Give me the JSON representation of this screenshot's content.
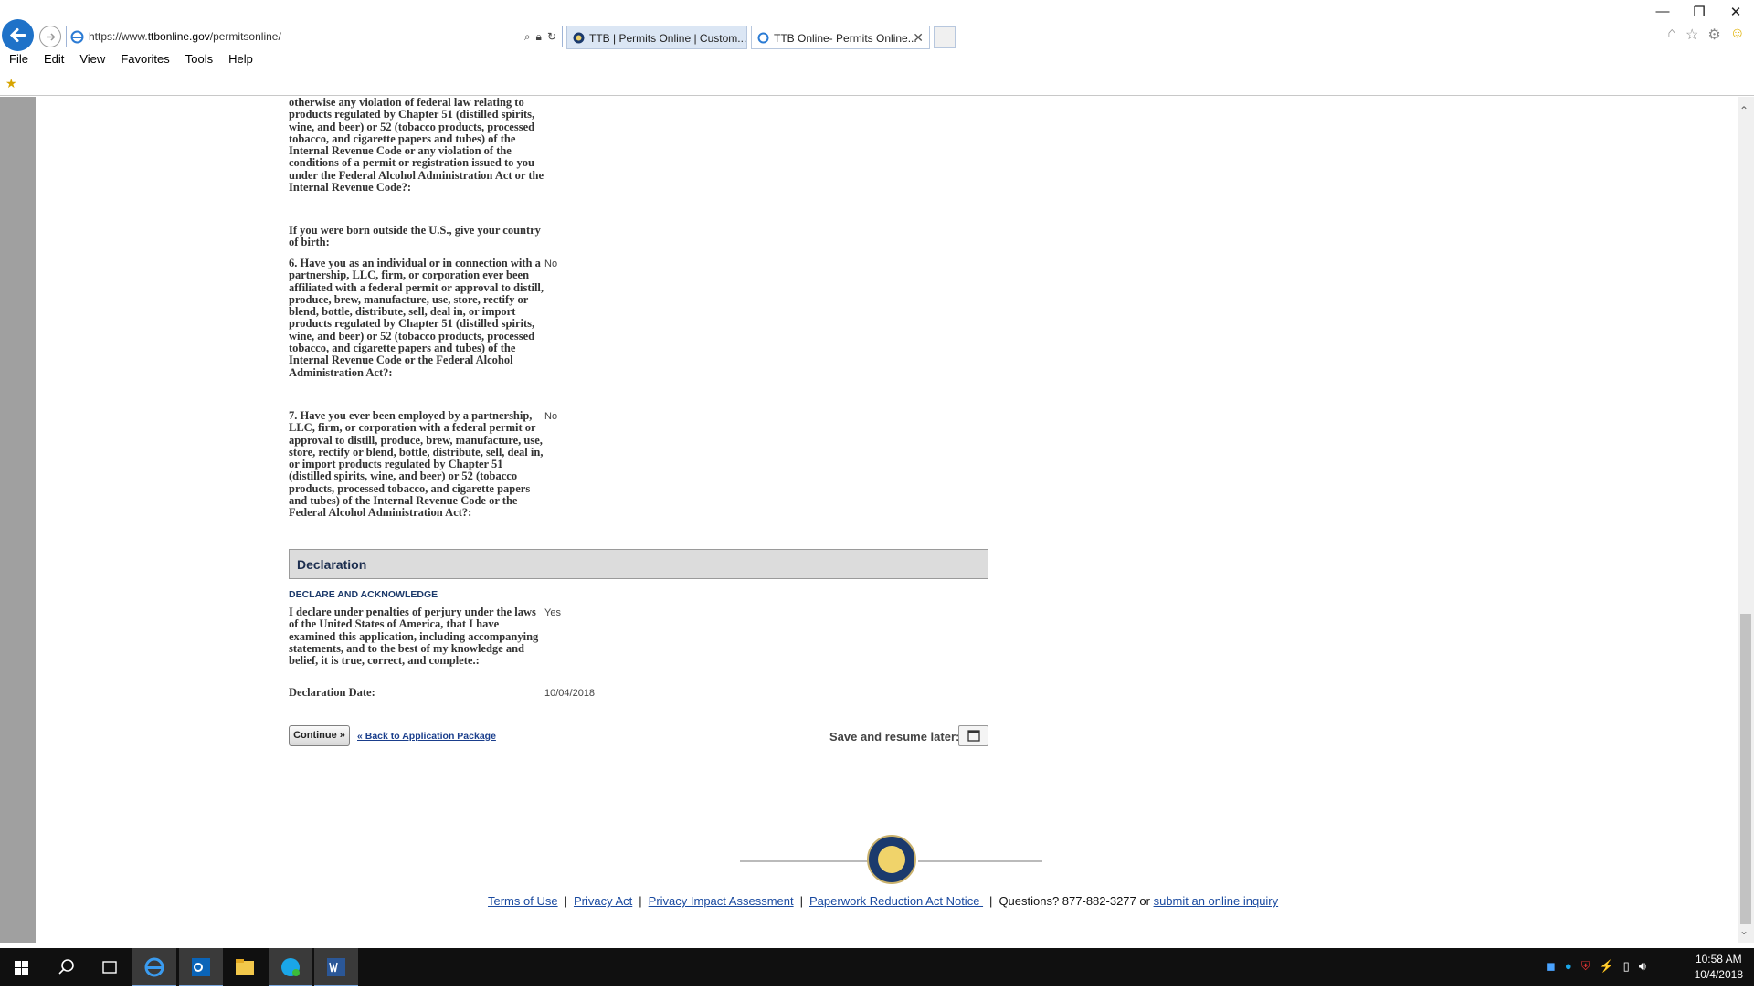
{
  "browser": {
    "url_prefix": "https://www.",
    "url_domain": "ttbonline.gov",
    "url_path": "/permitsonline/",
    "tabs": [
      {
        "label": "TTB | Permits Online | Custom..."
      },
      {
        "label": "TTB Online- Permits Online..."
      }
    ],
    "menu": [
      "File",
      "Edit",
      "View",
      "Favorites",
      "Tools",
      "Help"
    ]
  },
  "form": {
    "q5_tail": "otherwise any violation of federal law relating to products regulated by Chapter 51 (distilled spirits, wine, and beer) or 52 (tobacco products, processed tobacco, and cigarette papers and tubes) of the Internal Revenue Code or any violation of the conditions of a permit or registration issued to you under the Federal Alcohol Administration Act or the Internal Revenue Code?:",
    "birth_q": "If you were born outside the U.S., give your country of birth:",
    "q6": "6. Have you as an individual or in connection with a partnership, LLC, firm, or corporation ever been affiliated with a federal permit or approval to distill, produce, brew, manufacture, use, store, rectify or blend, bottle, distribute, sell, deal in, or import products regulated by Chapter 51 (distilled spirits, wine, and beer) or 52 (tobacco products, processed tobacco, and cigarette papers and tubes) of the Internal Revenue Code or the Federal Alcohol Administration Act?:",
    "q6_answer": "No",
    "q7": "7. Have you ever been employed by a partnership, LLC, firm, or corporation with a federal permit or approval to distill, produce, brew, manufacture, use, store, rectify or blend, bottle, distribute, sell, deal in, or import products regulated by Chapter 51 (distilled spirits, wine, and beer) or 52 (tobacco products, processed tobacco, and cigarette papers and tubes) of the Internal Revenue Code or the Federal Alcohol Administration Act?:",
    "q7_answer": "No",
    "declaration_title": "Declaration",
    "declaration_sub": "DECLARE AND ACKNOWLEDGE",
    "declare_q": "I declare under penalties of perjury under the laws of the United States of America, that I have examined this application, including accompanying statements, and to the best of my knowledge and belief, it is true, correct, and complete.:",
    "declare_answer": "Yes",
    "date_label": "Declaration Date:",
    "date_value": "10/04/2018",
    "continue_label": "Continue »",
    "back_link": "« Back to Application Package",
    "save_label": "Save and resume later:"
  },
  "footer": {
    "terms": "Terms of Use",
    "privacy": "Privacy Act",
    "pia": "Privacy Impact Assessment",
    "prn": "Paperwork Reduction Act Notice ",
    "questions": "Questions? 877-882-3277 or ",
    "inquiry": "submit an online inquiry"
  },
  "taskbar": {
    "time": "10:58 AM",
    "date": "10/4/2018"
  },
  "colors": {
    "accent": "#1f72c8",
    "link": "#1a4aa0"
  }
}
